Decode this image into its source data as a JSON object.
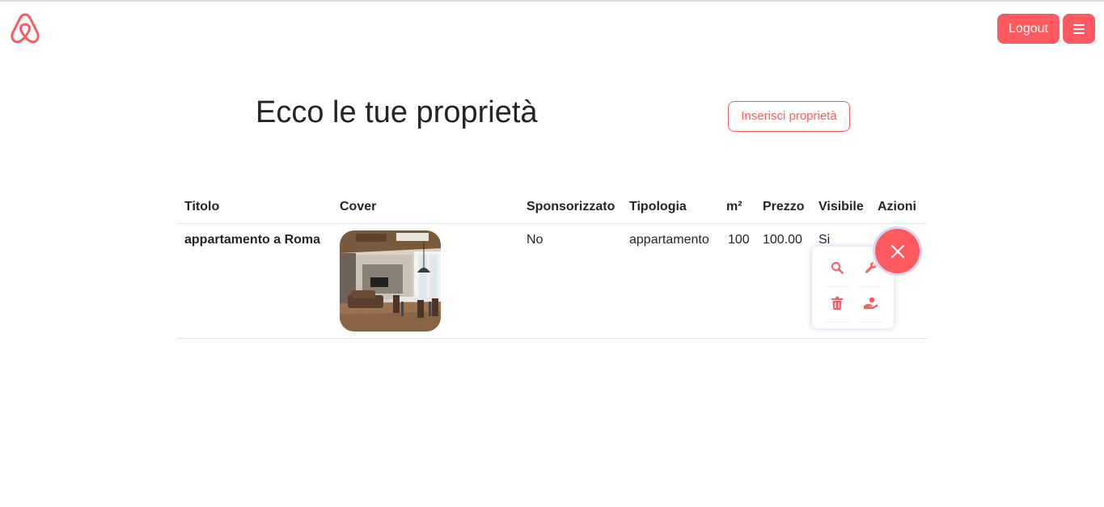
{
  "header": {
    "logo_icon": "airbnb-logo-icon",
    "logout_label": "Logout",
    "menu_icon": "hamburger-icon"
  },
  "main": {
    "title": "Ecco le tue proprietà",
    "insert_label": "Inserisci proprietà"
  },
  "table": {
    "columns": [
      "Titolo",
      "Cover",
      "Sponsorizzato",
      "Tipologia",
      "m²",
      "Prezzo",
      "Visibile",
      "Azioni"
    ],
    "rows": [
      {
        "titolo": "appartamento a Roma",
        "cover": "apartment-interior-photo",
        "sponsorizzato": "No",
        "tipologia": "appartamento",
        "mq": "100",
        "prezzo": "100.00",
        "visibile": "Si"
      }
    ]
  },
  "actions": {
    "close_icon": "close-icon",
    "items": [
      "search-icon",
      "wrench-icon",
      "trash-icon",
      "sponsor-hand-icon"
    ]
  },
  "colors": {
    "accent": "#ff5a5f",
    "text": "#212529",
    "border": "#dee2e6",
    "menu_shadow": "#d9d6f5"
  }
}
